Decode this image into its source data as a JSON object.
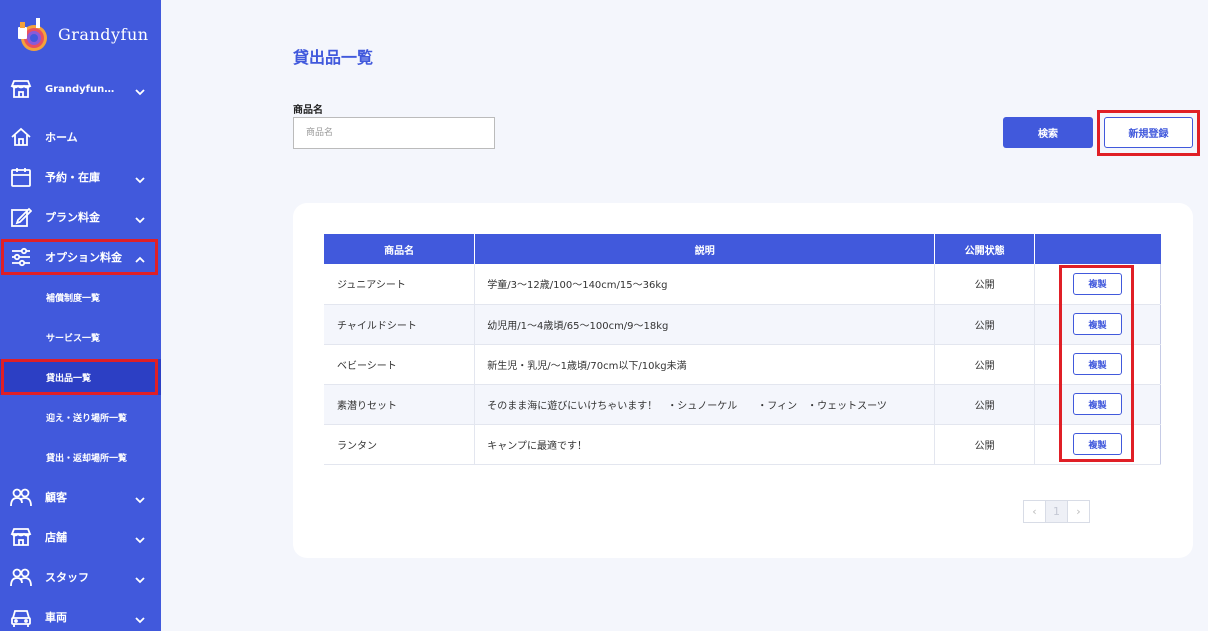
{
  "brand": {
    "name": "Grandyfun"
  },
  "sidebar": {
    "store_selector": "Grandyfun…",
    "items": [
      {
        "label": "ホーム"
      },
      {
        "label": "予約・在庫"
      },
      {
        "label": "プラン料金"
      },
      {
        "label": "オプション料金"
      },
      {
        "label": "顧客"
      },
      {
        "label": "店舗"
      },
      {
        "label": "スタッフ"
      },
      {
        "label": "車両"
      }
    ],
    "sub_items": [
      {
        "label": "補償制度一覧"
      },
      {
        "label": "サービス一覧"
      },
      {
        "label": "貸出品一覧"
      },
      {
        "label": "迎え・送り場所一覧"
      },
      {
        "label": "貸出・返却場所一覧"
      }
    ]
  },
  "main": {
    "title": "貸出品一覧",
    "search": {
      "label": "商品名",
      "placeholder": "商品名",
      "value": ""
    },
    "search_button": "検索",
    "new_button": "新規登録"
  },
  "table": {
    "headers": [
      "商品名",
      "説明",
      "公開状態",
      ""
    ],
    "rows": [
      {
        "name": "ジュニアシート",
        "description": "学童/3～12歳/100～140cm/15～36kg",
        "status": "公開",
        "action": "複製"
      },
      {
        "name": "チャイルドシート",
        "description": "幼児用/1～4歳頃/65～100cm/9～18kg",
        "status": "公開",
        "action": "複製"
      },
      {
        "name": "ベビーシート",
        "description": "新生児・乳児/～1歳頃/70cm以下/10kg未満",
        "status": "公開",
        "action": "複製"
      },
      {
        "name": "素潜りセット",
        "description": "そのまま海に遊びにいけちゃいます！　・シュノーケル　　・フィン　・ウェットスーツ",
        "status": "公開",
        "action": "複製"
      },
      {
        "name": "ランタン",
        "description": "キャンプに最適です！",
        "status": "公開",
        "action": "複製"
      }
    ]
  },
  "pagination": {
    "prev": "‹",
    "current": "1",
    "next": "›"
  },
  "colors": {
    "primary": "#4159dc",
    "active": "#2c3fc4",
    "highlight": "#e01f26",
    "background": "#f4f6fc"
  }
}
